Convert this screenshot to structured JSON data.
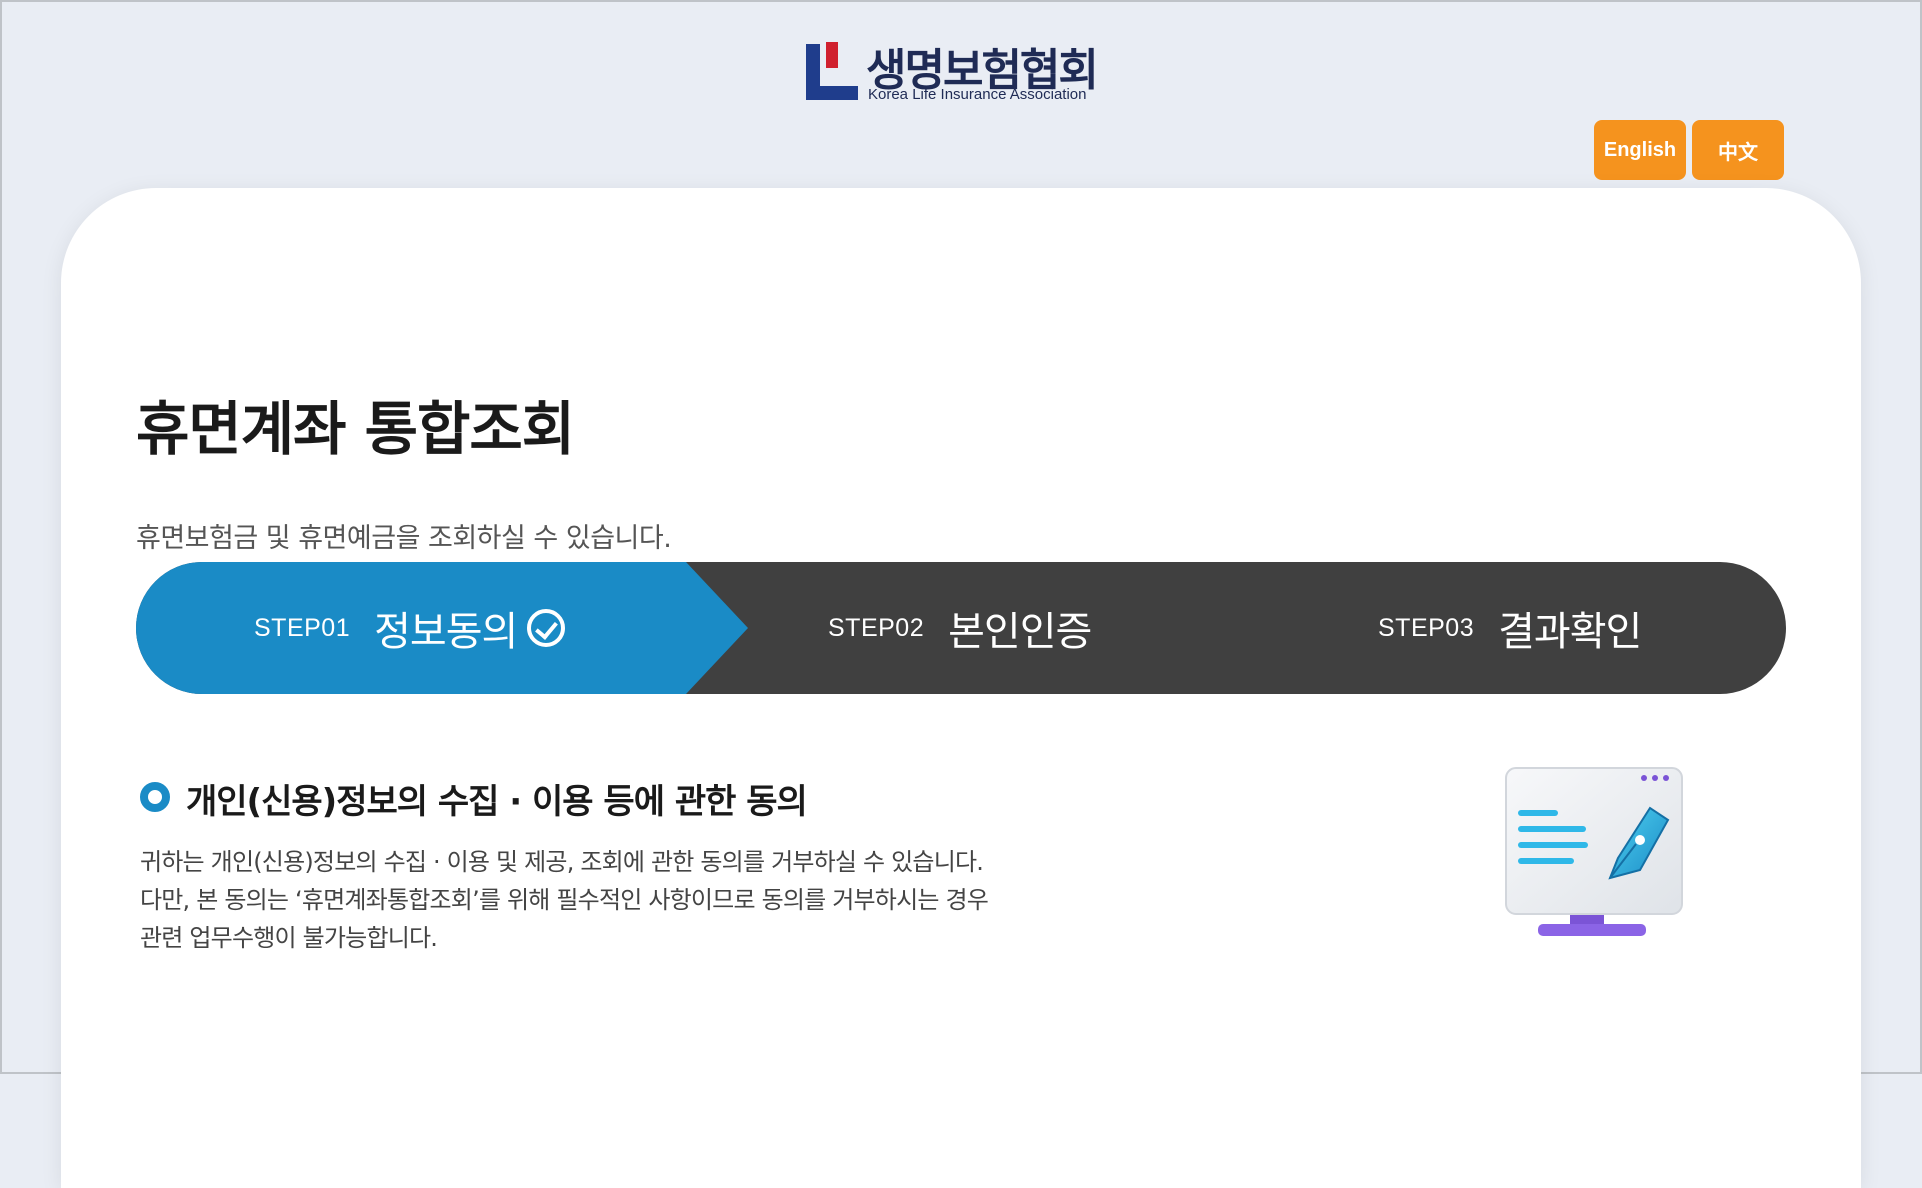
{
  "header": {
    "logo_text": "생명보험협회",
    "logo_subtext": "Korea Life Insurance Association"
  },
  "lang": {
    "english": "English",
    "chinese": "中文"
  },
  "page": {
    "title": "휴면계좌 통합조회",
    "subtitle": "휴면보험금 및 휴면예금을 조회하실 수 있습니다."
  },
  "steps": [
    {
      "num": "STEP01",
      "name": "정보동의",
      "active": true
    },
    {
      "num": "STEP02",
      "name": "본인인증",
      "active": false
    },
    {
      "num": "STEP03",
      "name": "결과확인",
      "active": false
    }
  ],
  "consent": {
    "title": "개인(신용)정보의 수집 · 이용 등에 관한 동의",
    "lines": [
      "귀하는 개인(신용)정보의 수집 · 이용 및 제공, 조회에 관한 동의를 거부하실 수 있습니다.",
      "다만, 본 동의는 ‘휴면계좌통합조회’를 위해 필수적인 사항이므로 동의를 거부하시는 경우",
      "관련 업무수행이 불가능합니다."
    ]
  },
  "colors": {
    "accent": "#1a8bc6",
    "inactive": "#404040",
    "orange": "#f5931e"
  }
}
